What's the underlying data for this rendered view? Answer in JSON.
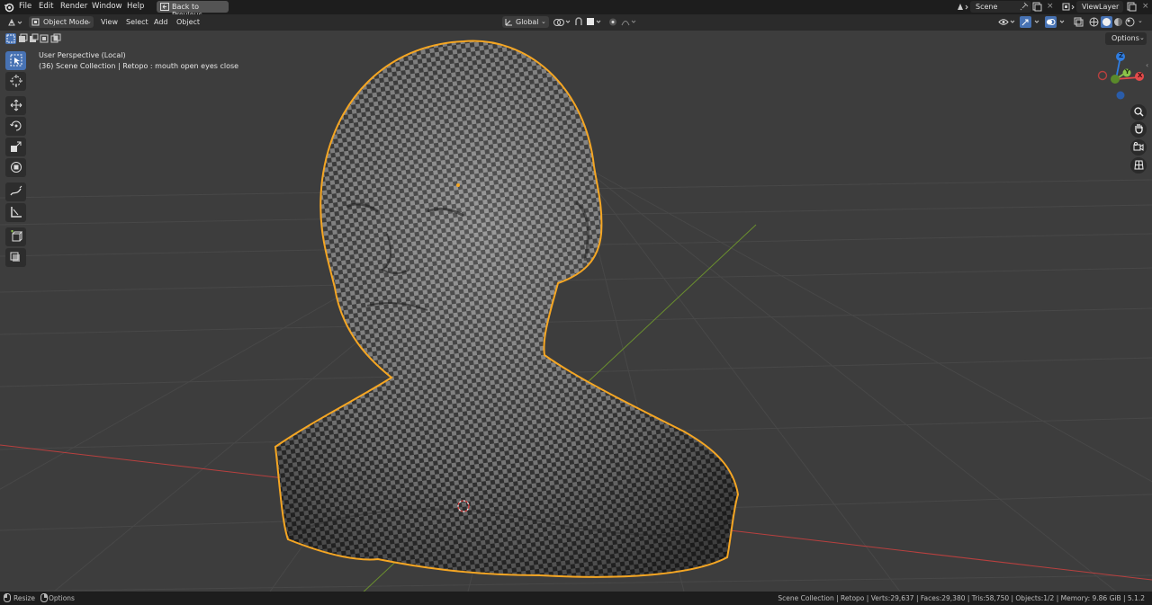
{
  "menu": {
    "file": "File",
    "edit": "Edit",
    "render": "Render",
    "window": "Window",
    "help": "Help",
    "back_to_previous": "Back to Previous"
  },
  "workspace": {
    "scene": "Scene",
    "view_layer": "ViewLayer"
  },
  "header": {
    "mode": "Object Mode",
    "view": "View",
    "select": "Select",
    "add": "Add",
    "object": "Object",
    "orientation": "Global",
    "options": "Options"
  },
  "overlay": {
    "perspective": "User Perspective (Local)",
    "collection": "(36) Scene Collection | Retopo : mouth open eyes close"
  },
  "gizmo": {
    "x": "X",
    "y": "Y",
    "z": "Z"
  },
  "status": {
    "resize": "Resize",
    "options": "Options",
    "stats": "Scene Collection | Retopo | Verts:29,637 | Faces:29,380 | Tris:58,750 | Objects:1/2 | Memory: 9.86 GiB | 5.1.2"
  },
  "colors": {
    "accent": "#4772b3",
    "selection": "#f5a623",
    "x_axis": "#e34a4a",
    "y_axis": "#8bc34a",
    "z_axis": "#2f7de1"
  },
  "icons": [
    "blender-logo-icon",
    "editor-type-icon",
    "select-box-icon",
    "cursor-icon",
    "move-icon",
    "rotate-icon",
    "scale-icon",
    "transform-icon",
    "annotate-icon",
    "measure-icon",
    "add-cube-icon",
    "zoom-icon",
    "hand-icon",
    "camera-icon",
    "grid-icon"
  ]
}
